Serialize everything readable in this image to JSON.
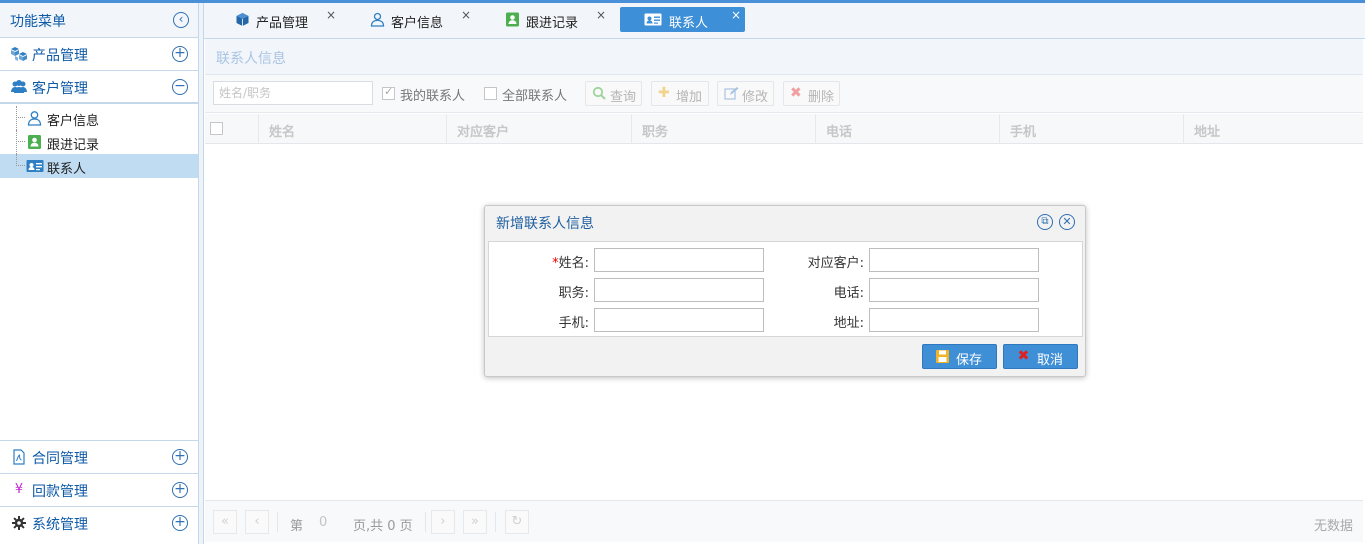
{
  "sidebar": {
    "title": "功能菜单",
    "sections": [
      {
        "label": "产品管理",
        "icon": "cubes-icon",
        "state": "collapsed"
      },
      {
        "label": "客户管理",
        "icon": "users-icon",
        "state": "expanded"
      }
    ],
    "tree": [
      {
        "label": "客户信息",
        "icon": "user-outline-icon"
      },
      {
        "label": "跟进记录",
        "icon": "contact-card-icon"
      },
      {
        "label": "联系人",
        "icon": "id-card-icon",
        "selected": true
      }
    ],
    "bottom_sections": [
      {
        "label": "合同管理",
        "icon": "document-icon"
      },
      {
        "label": "回款管理",
        "icon": "yen-icon"
      },
      {
        "label": "系统管理",
        "icon": "gear-icon"
      }
    ]
  },
  "tabs": [
    {
      "label": "产品管理",
      "icon": "cube-icon"
    },
    {
      "label": "客户信息",
      "icon": "user-outline-icon"
    },
    {
      "label": "跟进记录",
      "icon": "contact-card-icon"
    },
    {
      "label": "联系人",
      "icon": "id-card-icon",
      "active": true
    }
  ],
  "tab_close_glyph": "×",
  "panel": {
    "title": "联系人信息",
    "search_placeholder": "姓名/职务",
    "filter_mine": "我的联系人",
    "filter_all": "全部联系人",
    "filter_mine_checked": true,
    "filter_all_checked": false,
    "buttons": {
      "query": "查询",
      "add": "增加",
      "edit": "修改",
      "delete": "删除"
    },
    "columns": [
      "姓名",
      "对应客户",
      "职务",
      "电话",
      "手机",
      "地址"
    ]
  },
  "pager": {
    "page_prefix": "第",
    "page_value": "0",
    "page_suffix": "页,共 0 页",
    "status": "无数据"
  },
  "dialog": {
    "title": "新增联系人信息",
    "required_mark": "*",
    "fields": {
      "name": "姓名:",
      "customer": "对应客户:",
      "position": "职务:",
      "phone": "电话:",
      "mobile": "手机:",
      "address": "地址:"
    },
    "save": "保存",
    "cancel": "取消"
  },
  "colors": {
    "accent": "#3d8fd7",
    "title_blue": "#0e5aa7",
    "selected_row": "#c0dcf3",
    "cancel_icon": "#e02020",
    "save_icon": "#f0b429"
  }
}
